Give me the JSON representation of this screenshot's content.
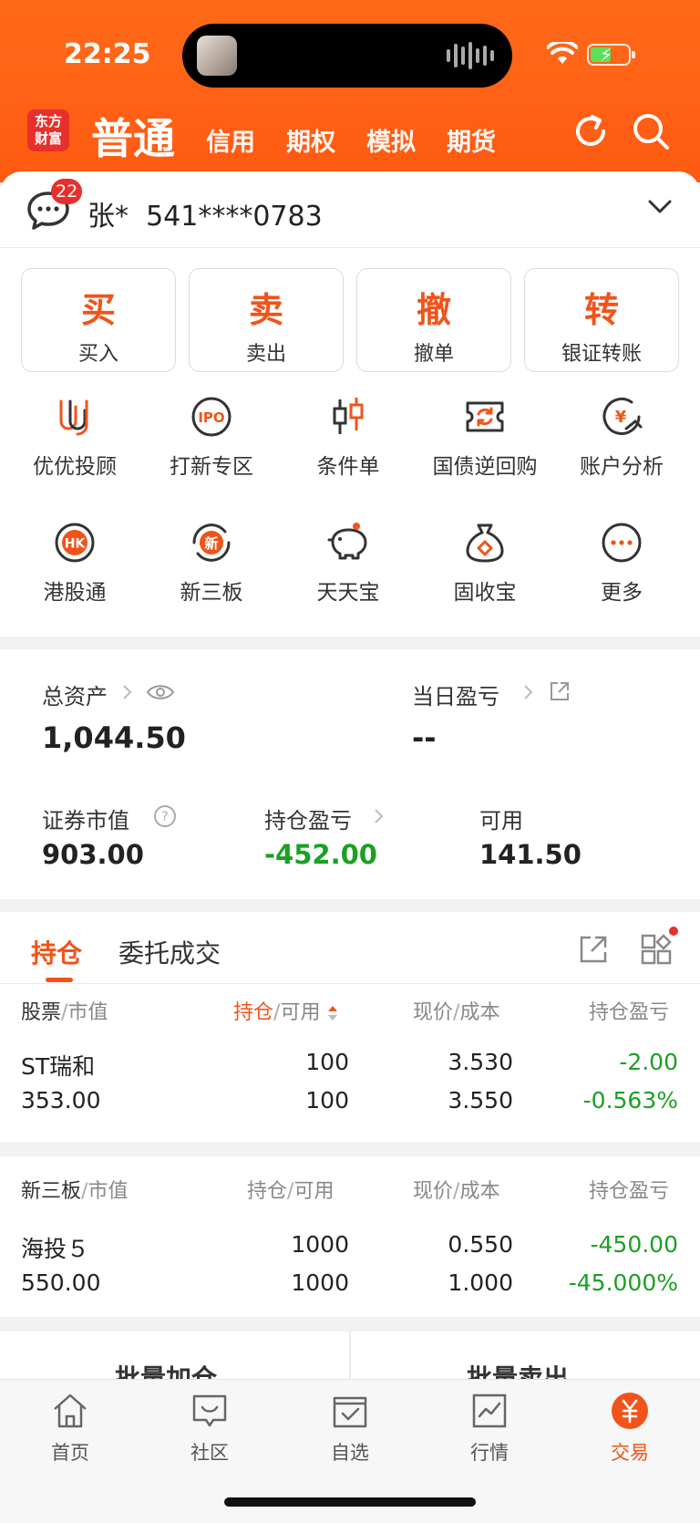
{
  "status": {
    "time": "22:25"
  },
  "header": {
    "logo": [
      "东方",
      "财富"
    ],
    "tabs": [
      "普通",
      "信用",
      "期权",
      "模拟",
      "期货"
    ],
    "brand_color": "#ff5a12"
  },
  "account": {
    "badge": "22",
    "name_label": "张*  541****0783"
  },
  "quick_actions": [
    {
      "big": "买",
      "small": "买入"
    },
    {
      "big": "卖",
      "small": "卖出"
    },
    {
      "big": "撤",
      "small": "撤单"
    },
    {
      "big": "转",
      "small": "银证转账"
    }
  ],
  "features": [
    {
      "label": "优优投顾",
      "icon": "uu-advisor-icon"
    },
    {
      "label": "打新专区",
      "icon": "ipo-icon",
      "icon_text": "IPO"
    },
    {
      "label": "条件单",
      "icon": "candlestick-icon"
    },
    {
      "label": "国债逆回购",
      "icon": "bond-repo-icon"
    },
    {
      "label": "账户分析",
      "icon": "yuan-chart-icon",
      "icon_text": "¥"
    },
    {
      "label": "港股通",
      "icon": "hk-icon",
      "icon_text": "HK"
    },
    {
      "label": "新三板",
      "icon": "new-third-board-icon",
      "icon_text": "新"
    },
    {
      "label": "天天宝",
      "icon": "piggy-bank-icon"
    },
    {
      "label": "固收宝",
      "icon": "money-bag-icon"
    },
    {
      "label": "更多",
      "icon": "more-icon"
    }
  ],
  "assets": {
    "total_label": "总资产",
    "total_value": "1,044.50",
    "daily_pl_label": "当日盈亏",
    "daily_pl_value": "--",
    "market_value_label": "证券市值",
    "market_value": "903.00",
    "position_pl_label": "持仓盈亏",
    "position_pl_value": "-452.00",
    "available_label": "可用",
    "available_value": "141.50",
    "loss_color": "#1ba024"
  },
  "positions": {
    "tabs": [
      "持仓",
      "委托成交"
    ],
    "headers": {
      "stock": "股票",
      "market_value": "市值",
      "hold": "持仓",
      "available": "可用",
      "price": "现价",
      "cost": "成本",
      "pl": "持仓盈亏"
    },
    "rows": [
      {
        "name": "ST瑞和",
        "market_value": "353.00",
        "hold": "100",
        "available": "100",
        "price": "3.530",
        "cost": "3.550",
        "pl": "-2.00",
        "pl_pct": "-0.563%"
      }
    ]
  },
  "new_third_board": {
    "headers": {
      "stock": "新三板",
      "market_value": "市值",
      "hold": "持仓",
      "available": "可用",
      "price": "现价",
      "cost": "成本",
      "pl": "持仓盈亏"
    },
    "rows": [
      {
        "name": "海投５",
        "market_value": "550.00",
        "hold": "1000",
        "available": "1000",
        "price": "0.550",
        "cost": "1.000",
        "pl": "-450.00",
        "pl_pct": "-45.000%"
      }
    ]
  },
  "batch": {
    "add": "批量加仓",
    "sell": "批量卖出"
  },
  "bottom_nav": [
    {
      "label": "首页",
      "icon": "home-icon"
    },
    {
      "label": "社区",
      "icon": "community-icon"
    },
    {
      "label": "自选",
      "icon": "watchlist-icon"
    },
    {
      "label": "行情",
      "icon": "market-icon"
    },
    {
      "label": "交易",
      "icon": "trade-icon",
      "active": true
    }
  ]
}
